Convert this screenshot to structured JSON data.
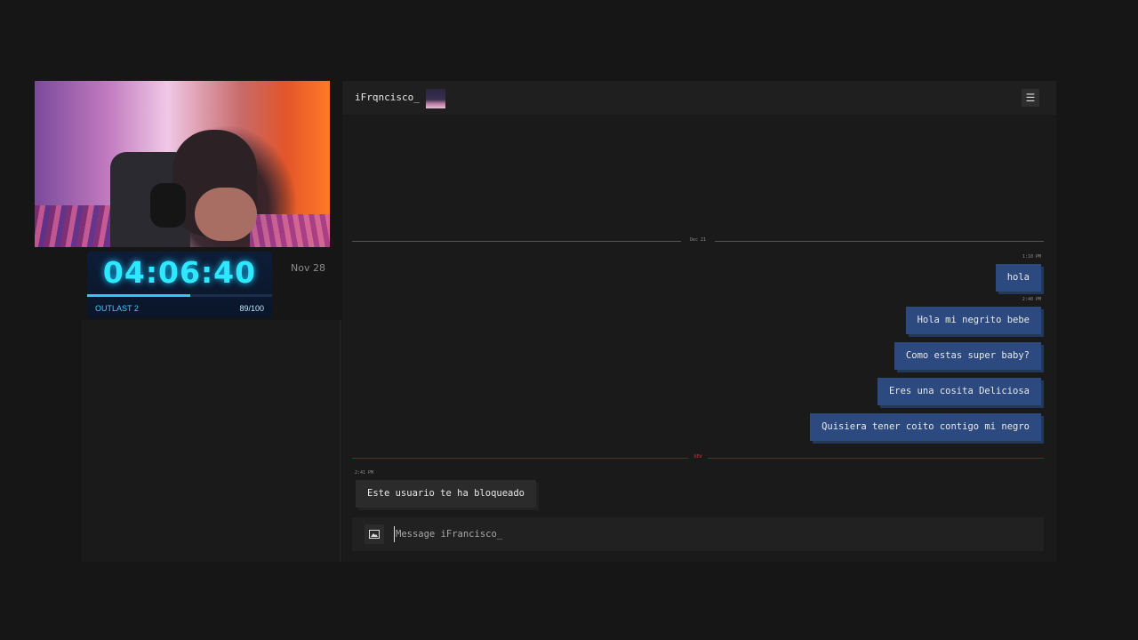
{
  "overlay": {
    "timer": "04:06:40",
    "timer_progress": 0.56,
    "game": "OUTLAST 2",
    "progress_count": "89/100",
    "date": "Nov 28"
  },
  "chat": {
    "username": "iFrqncisco_",
    "date_divider": "Dec 21",
    "new_divider": "NEW",
    "messages": [
      {
        "time": "1:10 PM",
        "text": "hola"
      },
      {
        "time": "2:40 PM",
        "text": "Hola mi negrito bebe"
      },
      {
        "time": "",
        "text": "Como estas super baby?"
      },
      {
        "time": "",
        "text": "Eres una cosita Deliciosa"
      },
      {
        "time": "",
        "text": "Quisiera tener coito contigo mi negro"
      }
    ],
    "system_message": {
      "time": "2:41 PM",
      "text": "Este usuario te ha bloqueado"
    },
    "composer_placeholder": "Message iFrancisco_"
  },
  "icons": {
    "menu": "hamburger-icon",
    "image": "image-icon"
  },
  "colors": {
    "outgoing_bubble": "#2c4a80",
    "new_divider": "#7a1f1f",
    "timer_accent": "#2ee8ff"
  }
}
